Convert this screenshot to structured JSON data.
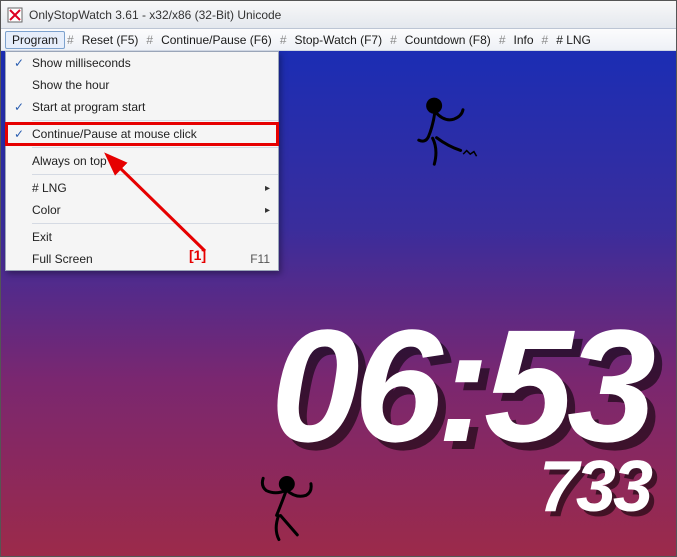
{
  "window": {
    "title": "OnlyStopWatch 3.61 - x32/x86 (32-Bit) Unicode"
  },
  "menubar": {
    "program": "Program",
    "reset": "Reset  (F5)",
    "continue": "Continue/Pause  (F6)",
    "stopwatch": "Stop-Watch  (F7)",
    "countdown": "Countdown  (F8)",
    "info": "Info",
    "lng": "# LNG",
    "sep": "#"
  },
  "menu": {
    "items": [
      {
        "label": "Show milliseconds",
        "checked": true
      },
      {
        "label": "Show the hour",
        "checked": false
      },
      {
        "label": "Start at program start",
        "checked": true
      },
      {
        "label": "Continue/Pause at mouse click",
        "checked": true,
        "highlight": true
      },
      {
        "label": "Always on top",
        "checked": false
      },
      {
        "label": "# LNG",
        "submenu": true
      },
      {
        "label": "Color",
        "submenu": true
      },
      {
        "label": "Exit"
      },
      {
        "label": "Full Screen",
        "accel": "F11"
      }
    ]
  },
  "timer": {
    "main": "06:53",
    "ms": "733"
  },
  "annotation": {
    "label": "[1]"
  }
}
